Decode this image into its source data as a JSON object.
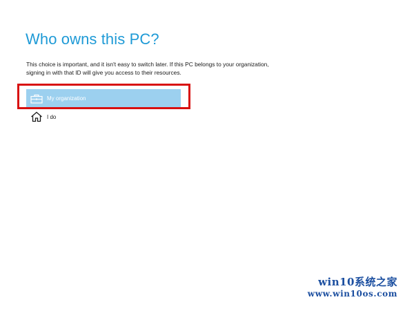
{
  "page": {
    "title": "Who owns this PC?",
    "description": "This choice is important, and it isn't easy to switch later. If this PC belongs to your organization, signing in with that ID will give you access to their resources."
  },
  "options": [
    {
      "label": "My organization",
      "icon": "briefcase-icon",
      "selected": true
    },
    {
      "label": "I do",
      "icon": "home-icon",
      "selected": false
    }
  ],
  "annotation": {
    "highlight_color": "#d80f0f"
  },
  "watermark": {
    "line1": "win10系统之家",
    "line2": "www.win10os.com"
  },
  "colors": {
    "title": "#1e9ad6",
    "selected_background": "#9cd0ef",
    "watermark": "#1c4fa0"
  }
}
